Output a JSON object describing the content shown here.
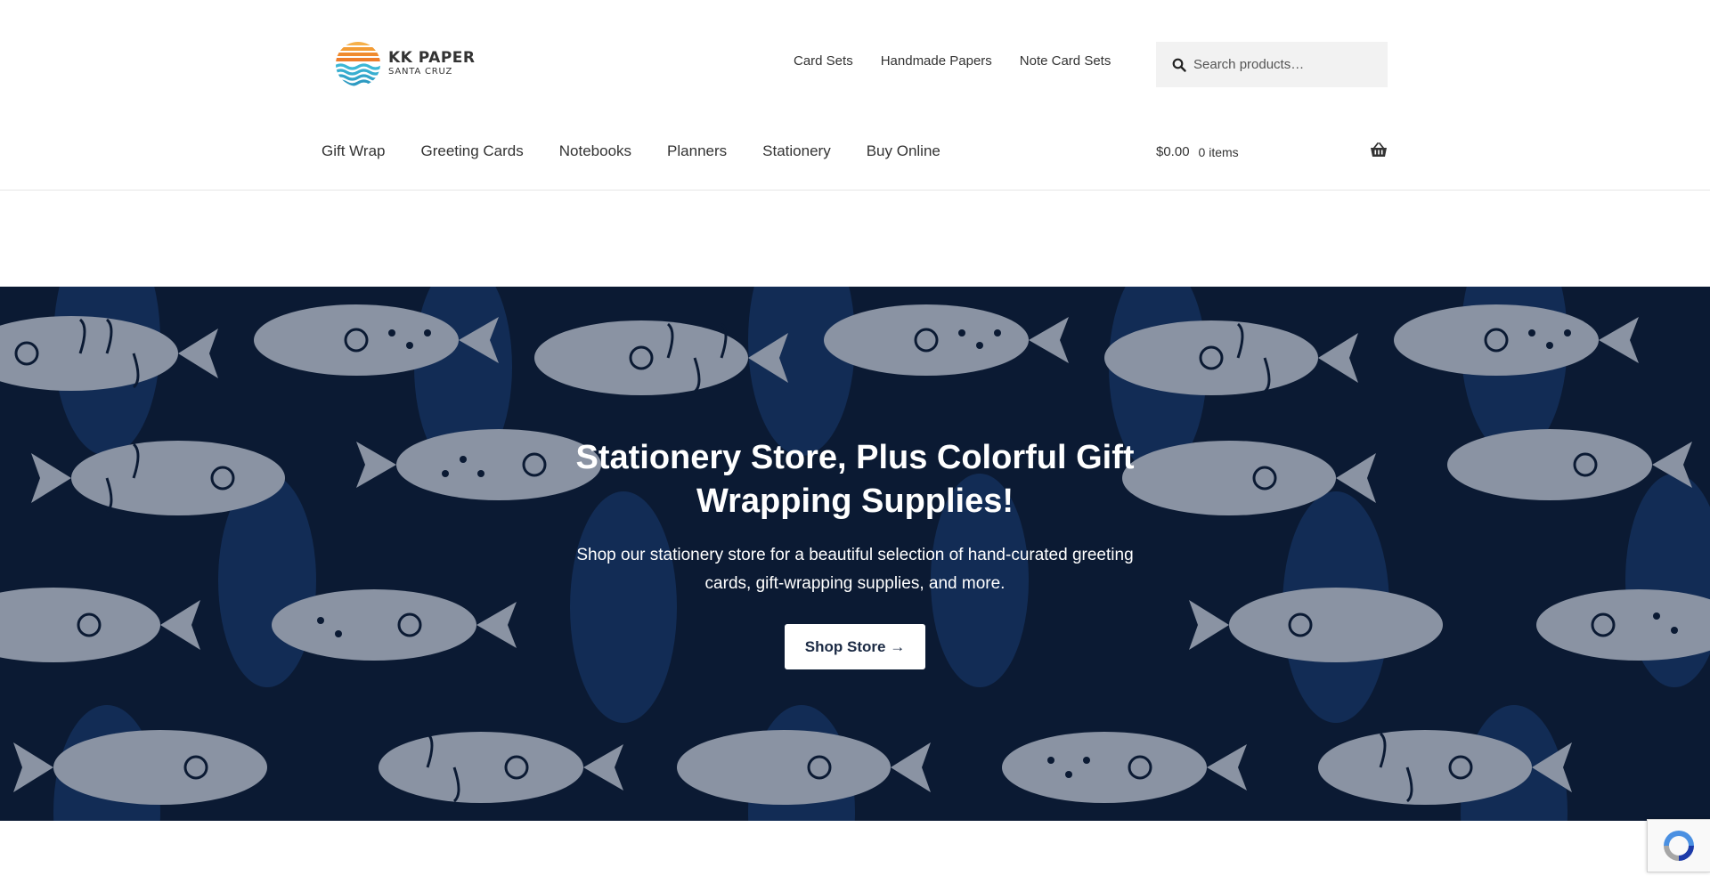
{
  "logo": {
    "title": "KK PAPER",
    "subtitle": "SANTA CRUZ"
  },
  "secondary_nav": [
    {
      "label": "Card Sets"
    },
    {
      "label": "Handmade Papers"
    },
    {
      "label": "Note Card Sets"
    }
  ],
  "search": {
    "placeholder": "Search products…"
  },
  "primary_nav": [
    {
      "label": "Gift Wrap"
    },
    {
      "label": "Greeting Cards"
    },
    {
      "label": "Notebooks"
    },
    {
      "label": "Planners"
    },
    {
      "label": "Stationery"
    },
    {
      "label": "Buy Online"
    }
  ],
  "cart": {
    "amount": "$0.00",
    "count": "0 items"
  },
  "hero": {
    "title": "Stationery Store, Plus Colorful Gift Wrapping Supplies!",
    "text": "Shop our stationery store for a beautiful selection of hand-curated greeting cards, gift-wrapping supplies, and more.",
    "button_label": "Shop Store →"
  },
  "icons": {
    "search": "search-icon",
    "cart": "basket-icon",
    "recaptcha": "recaptcha-icon"
  },
  "colors": {
    "hero_bg": "#0b1a33",
    "pattern": "#8a93a3",
    "button_text": "#1b2a44",
    "logo_orange": "#f3a23a",
    "logo_blue": "#3cb7d6"
  }
}
